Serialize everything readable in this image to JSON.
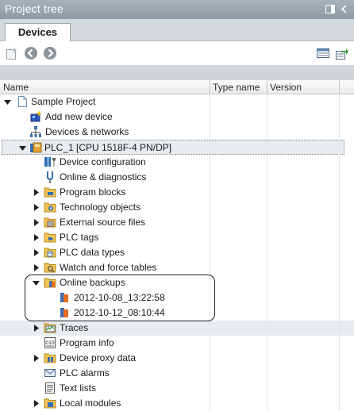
{
  "window": {
    "title": "Project tree"
  },
  "tabs": [
    {
      "label": "Devices"
    }
  ],
  "columns": {
    "name": "Name",
    "type_name": "Type name",
    "version": "Version"
  },
  "tree": [
    {
      "label": "Sample Project",
      "icon": "project-icon"
    },
    {
      "label": "Add new device",
      "icon": "add-device-icon"
    },
    {
      "label": "Devices & networks",
      "icon": "network-icon"
    },
    {
      "label": "PLC_1 [CPU 1518F-4 PN/DP]",
      "icon": "plc-icon"
    },
    {
      "label": "Device configuration",
      "icon": "device-config-icon"
    },
    {
      "label": "Online & diagnostics",
      "icon": "diagnostics-icon"
    },
    {
      "label": "Program blocks",
      "icon": "folder-icon"
    },
    {
      "label": "Technology objects",
      "icon": "folder-icon"
    },
    {
      "label": "External source files",
      "icon": "folder-icon"
    },
    {
      "label": "PLC tags",
      "icon": "folder-icon"
    },
    {
      "label": "PLC data types",
      "icon": "folder-icon"
    },
    {
      "label": "Watch and force tables",
      "icon": "folder-icon"
    },
    {
      "label": "Online backups",
      "icon": "backup-folder-icon"
    },
    {
      "label": "2012-10-08_13:22:58",
      "icon": "backup-icon"
    },
    {
      "label": "2012-10-12_08:10:44",
      "icon": "backup-icon"
    },
    {
      "label": "Traces",
      "icon": "traces-icon"
    },
    {
      "label": "Program info",
      "icon": "program-info-icon"
    },
    {
      "label": "Device proxy data",
      "icon": "folder-icon"
    },
    {
      "label": "PLC alarms",
      "icon": "alarms-icon"
    },
    {
      "label": "Text lists",
      "icon": "text-lists-icon"
    },
    {
      "label": "Local modules",
      "icon": "folder-icon"
    }
  ]
}
